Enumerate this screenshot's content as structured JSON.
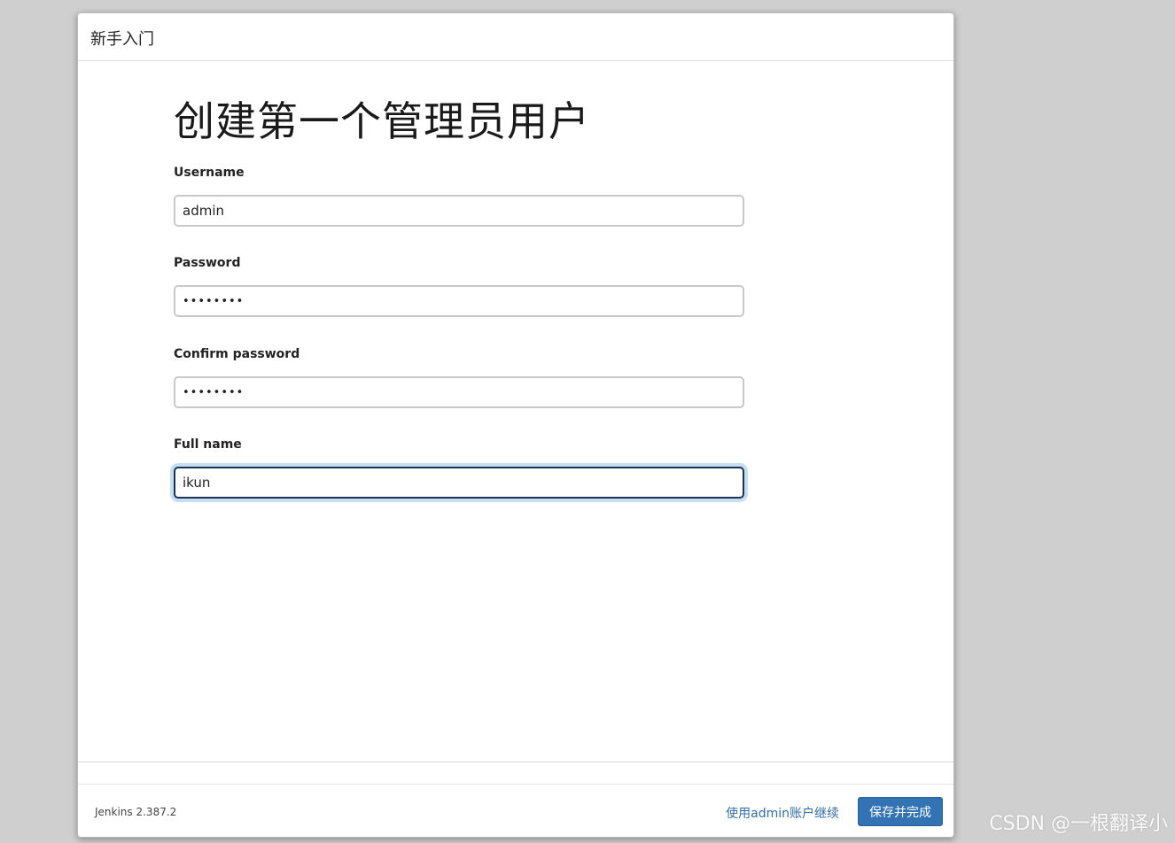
{
  "dialog": {
    "header_title": "新手入门",
    "page_title": "创建第一个管理员用户"
  },
  "form": {
    "username": {
      "label": "Username",
      "value": "admin"
    },
    "password": {
      "label": "Password",
      "value": "••••••••"
    },
    "confirm_password": {
      "label": "Confirm password",
      "value": "••••••••"
    },
    "full_name": {
      "label": "Full name",
      "value": "ikun"
    }
  },
  "footer": {
    "version": "Jenkins 2.387.2",
    "continue_link": "使用admin账户继续",
    "save_button": "保存并完成"
  },
  "watermark": "CSDN @一根翻译小"
}
